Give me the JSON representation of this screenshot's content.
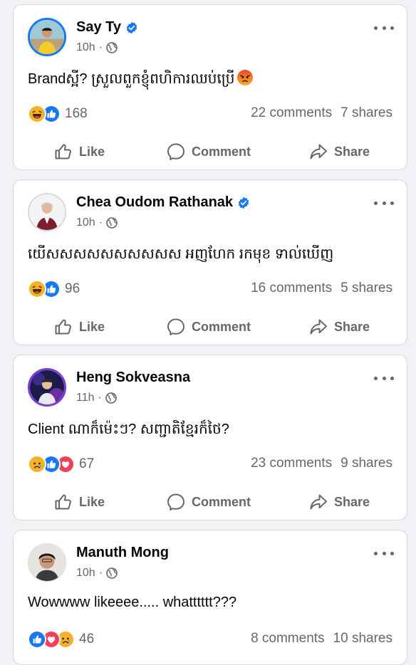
{
  "colors": {
    "verified": "#1877f2",
    "like": "#1877f2",
    "love": "#f33e58",
    "haha": "#f7b125",
    "angry": "#e9710f",
    "secondary_text": "#65676b"
  },
  "actions": {
    "like": "Like",
    "comment": "Comment",
    "share": "Share"
  },
  "posts": [
    {
      "author": "Say Ty",
      "verified": true,
      "time": "10h",
      "visibility_icon": "globe-icon",
      "text": "Brandស្អី? ស្រួលពួកខ្ញុំពហិការឈប់ប្រើ",
      "text_emoji": "angry-face",
      "reactions": [
        "haha",
        "like"
      ],
      "reaction_count": "168",
      "comments": "22 comments",
      "shares": "7 shares"
    },
    {
      "author": "Chea Oudom Rathanak",
      "verified": true,
      "time": "10h",
      "visibility_icon": "globe-icon",
      "text": "យើសសសសសសសសសស អញហែក រកមុខ ទាល់ឃើញ",
      "reactions": [
        "haha",
        "like"
      ],
      "reaction_count": "96",
      "comments": "16 comments",
      "shares": "5 shares"
    },
    {
      "author": "Heng Sokveasna",
      "verified": false,
      "time": "11h",
      "visibility_icon": "globe-icon",
      "text": "Client ណាក៏ម៉េះៗ? សញ្ជាតិខ្មែរក៏ថៃ?",
      "reactions": [
        "sad",
        "like",
        "love"
      ],
      "reaction_count": "67",
      "comments": "23 comments",
      "shares": "9 shares"
    },
    {
      "author": "Manuth Mong",
      "verified": false,
      "time": "10h",
      "visibility_icon": "globe-icon",
      "text": "Wowwww likeeee..... whatttttt???",
      "reactions": [
        "like",
        "love",
        "sad"
      ],
      "reaction_count": "46",
      "comments": "8 comments",
      "shares": "10 shares"
    }
  ]
}
